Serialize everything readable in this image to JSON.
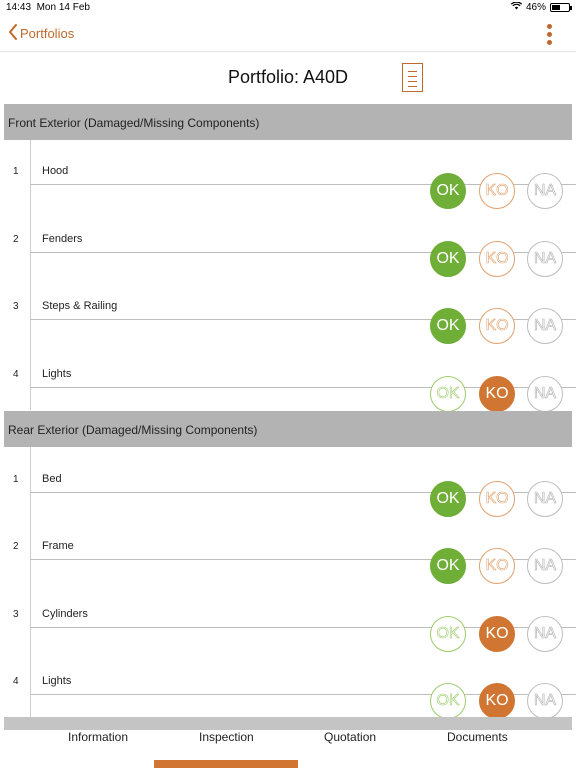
{
  "status": {
    "time": "14:43",
    "date": "Mon 14 Feb",
    "battery": "46%"
  },
  "nav": {
    "back_label": "Portfolios",
    "more_icon": "more-vertical-icon"
  },
  "page": {
    "title": "Portfolio: A40D",
    "doc_icon": "document-icon"
  },
  "colors": {
    "accent": "#c0692a",
    "ok": "#6fae37",
    "ko": "#d07632",
    "na": "#bdbdbd",
    "section_bg": "#b3b3b3"
  },
  "sections": [
    {
      "title": "Front Exterior (Damaged/Missing Components)",
      "items": [
        {
          "num": "1",
          "label": "Hood",
          "status": "OK"
        },
        {
          "num": "2",
          "label": "Fenders",
          "status": "OK"
        },
        {
          "num": "3",
          "label": "Steps & Railing",
          "status": "OK"
        },
        {
          "num": "4",
          "label": "Lights",
          "status": "KO"
        }
      ]
    },
    {
      "title": "Rear Exterior  (Damaged/Missing Components)",
      "items": [
        {
          "num": "1",
          "label": "Bed",
          "status": "OK"
        },
        {
          "num": "2",
          "label": "Frame",
          "status": "OK"
        },
        {
          "num": "3",
          "label": "Cylinders",
          "status": "KO"
        },
        {
          "num": "4",
          "label": "Lights",
          "status": "KO"
        }
      ]
    }
  ],
  "buttons": {
    "ok": "OK",
    "ko": "KO",
    "na": "NA"
  },
  "tabs": [
    {
      "label": "Information",
      "active": false
    },
    {
      "label": "Inspection",
      "active": true
    },
    {
      "label": "Quotation",
      "active": false
    },
    {
      "label": "Documents",
      "active": false
    }
  ]
}
